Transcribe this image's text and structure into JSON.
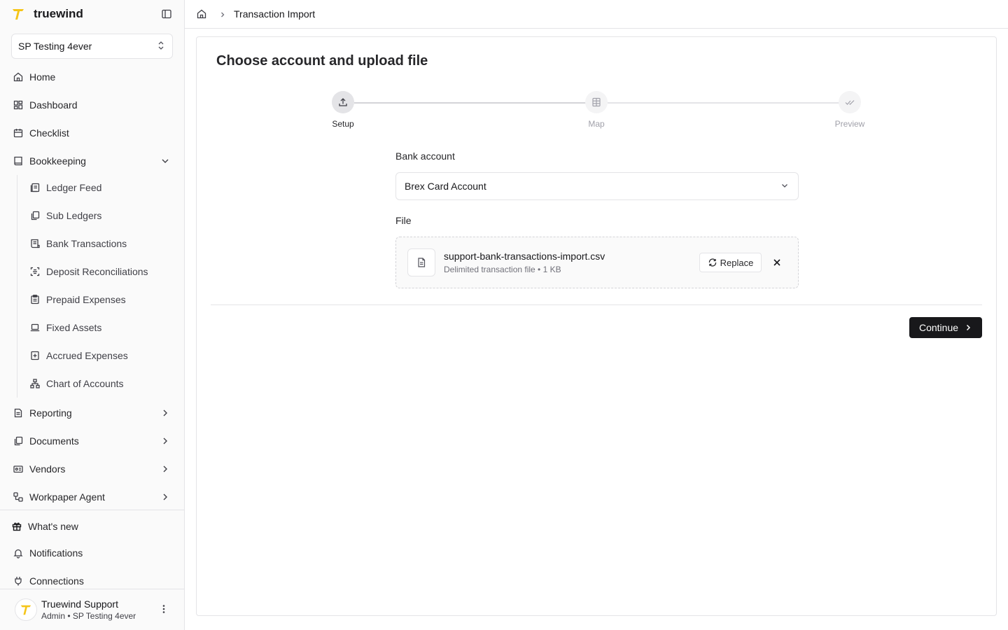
{
  "brand": {
    "name": "truewind",
    "accent": "#f5c518"
  },
  "org_selector": {
    "value": "SP Testing 4ever"
  },
  "nav": {
    "home": "Home",
    "dashboard": "Dashboard",
    "checklist": "Checklist",
    "bookkeeping": "Bookkeeping",
    "bookkeeping_items": [
      {
        "label": "Ledger Feed",
        "icon": "ledger-icon"
      },
      {
        "label": "Sub Ledgers",
        "icon": "copy-icon"
      },
      {
        "label": "Bank Transactions",
        "icon": "receipt-icon"
      },
      {
        "label": "Deposit Reconciliations",
        "icon": "scan-icon"
      },
      {
        "label": "Prepaid Expenses",
        "icon": "clipboard-icon"
      },
      {
        "label": "Fixed Assets",
        "icon": "laptop-icon"
      },
      {
        "label": "Accrued Expenses",
        "icon": "plus-square-icon"
      },
      {
        "label": "Chart of Accounts",
        "icon": "network-icon"
      }
    ],
    "reporting": "Reporting",
    "documents": "Documents",
    "vendors": "Vendors",
    "workpaper_agent": "Workpaper Agent",
    "whats_new": "What's new",
    "notifications": "Notifications",
    "connections": "Connections"
  },
  "user": {
    "name": "Truewind Support",
    "role": "Admin • SP Testing 4ever"
  },
  "breadcrumb": {
    "current": "Transaction Import"
  },
  "page": {
    "title": "Choose account and upload file",
    "steps": [
      {
        "label": "Setup",
        "state": "active"
      },
      {
        "label": "Map",
        "state": "inactive"
      },
      {
        "label": "Preview",
        "state": "inactive"
      }
    ],
    "bank_account": {
      "label": "Bank account",
      "value": "Brex Card Account"
    },
    "file": {
      "label": "File",
      "name": "support-bank-transactions-import.csv",
      "meta": "Delimited transaction file • 1 KB",
      "replace_label": "Replace"
    },
    "continue_label": "Continue"
  }
}
